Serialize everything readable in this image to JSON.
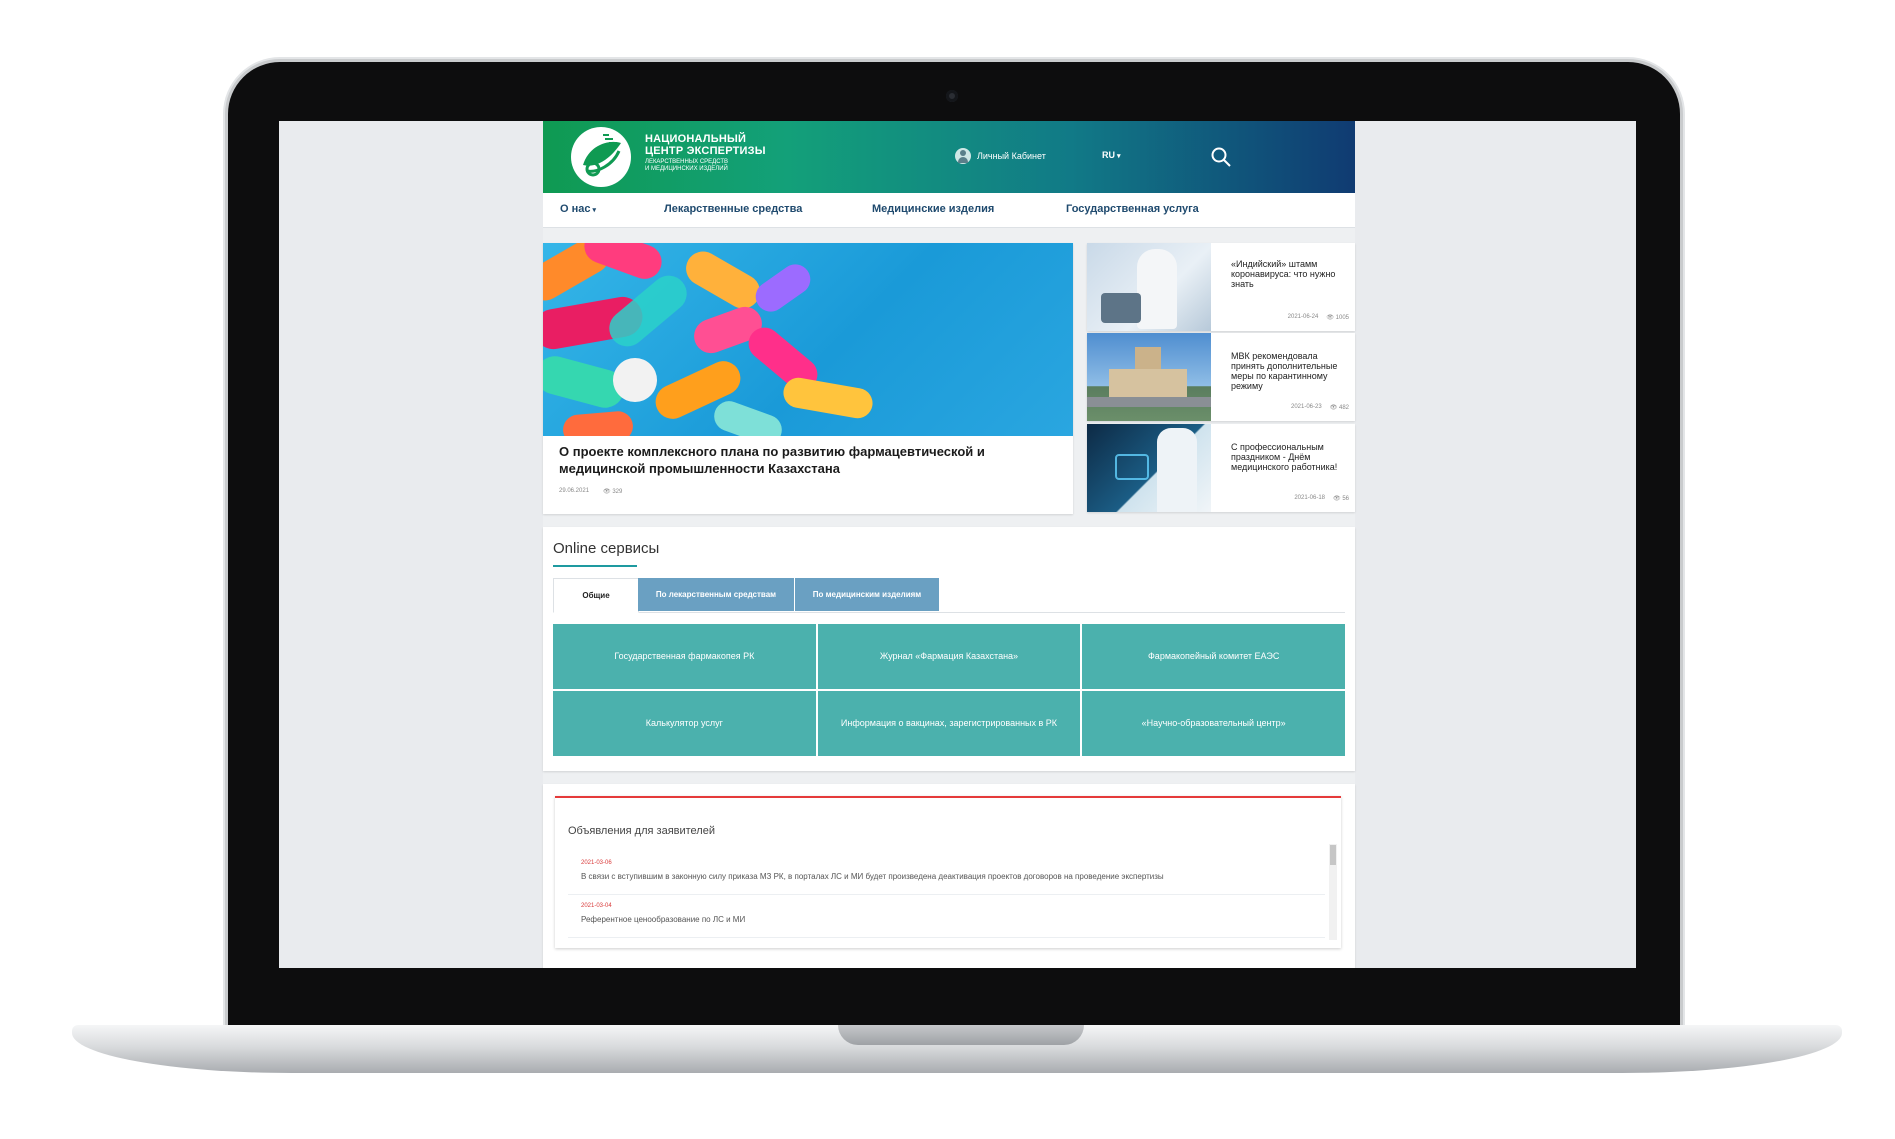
{
  "site": {
    "logo": {
      "line1": "НАЦИОНАЛЬНЫЙ",
      "line2": "ЦЕНТР ЭКСПЕРТИЗЫ",
      "line3": "ЛЕКАРСТВЕННЫХ СРЕДСТВ",
      "line4": "И МЕДИЦИНСКИХ ИЗДЕЛИЙ"
    },
    "header": {
      "cabinet_label": "Личный Кабинет",
      "language": "RU",
      "caret": "▾"
    },
    "nav": {
      "about": "О нас",
      "about_caret": "▾",
      "drugs": "Лекарственные средства",
      "devices": "Медицинские изделия",
      "gov_service": "Государственная услуга"
    },
    "hero": {
      "title": "О проекте комплексного плана по развитию фармацевтической и медицинской промышленности Казахстана",
      "date": "29.06.2021",
      "views": "329"
    },
    "side_news": [
      {
        "title": "«Индийский» штамм коронавируса: что нужно знать",
        "date": "2021-06-24",
        "views": "1005"
      },
      {
        "title": "МВК рекомендовала принять дополнительные меры по карантинному режиму",
        "date": "2021-06-23",
        "views": "482"
      },
      {
        "title": "С профессиональным праздником - Днём медицинского работника!",
        "date": "2021-06-18",
        "views": "56"
      }
    ],
    "services": {
      "title": "Online сервисы",
      "tabs": [
        "Общие",
        "По лекарственным средствам",
        "По медицинским изделиям"
      ],
      "items": [
        "Государственная фармакопея РК",
        "Журнал «Фармация Казахстана»",
        "Фармакопейный комитет ЕАЭС",
        "Калькулятор услуг",
        "Информация о вакцинах, зарегистрированных в РК",
        "«Научно-образовательный центр»"
      ]
    },
    "announcements": {
      "title": "Объявления для заявителей",
      "items": [
        {
          "date": "2021-03-06",
          "text": "В связи с вступившим в законную силу приказа МЗ РК, в порталах ЛС и МИ будет произведена деактивация проектов договоров на проведение экспертизы"
        },
        {
          "date": "2021-03-04",
          "text": "Референтное ценообразование по ЛС и МИ"
        }
      ]
    }
  },
  "colors": {
    "header_start": "#0f9a52",
    "header_end": "#103b72",
    "service_tile": "#4bb1ad",
    "tab_blue": "#6aa0c2",
    "nav_text": "#1f4a6e",
    "announcement_accent": "#e53a3a"
  }
}
